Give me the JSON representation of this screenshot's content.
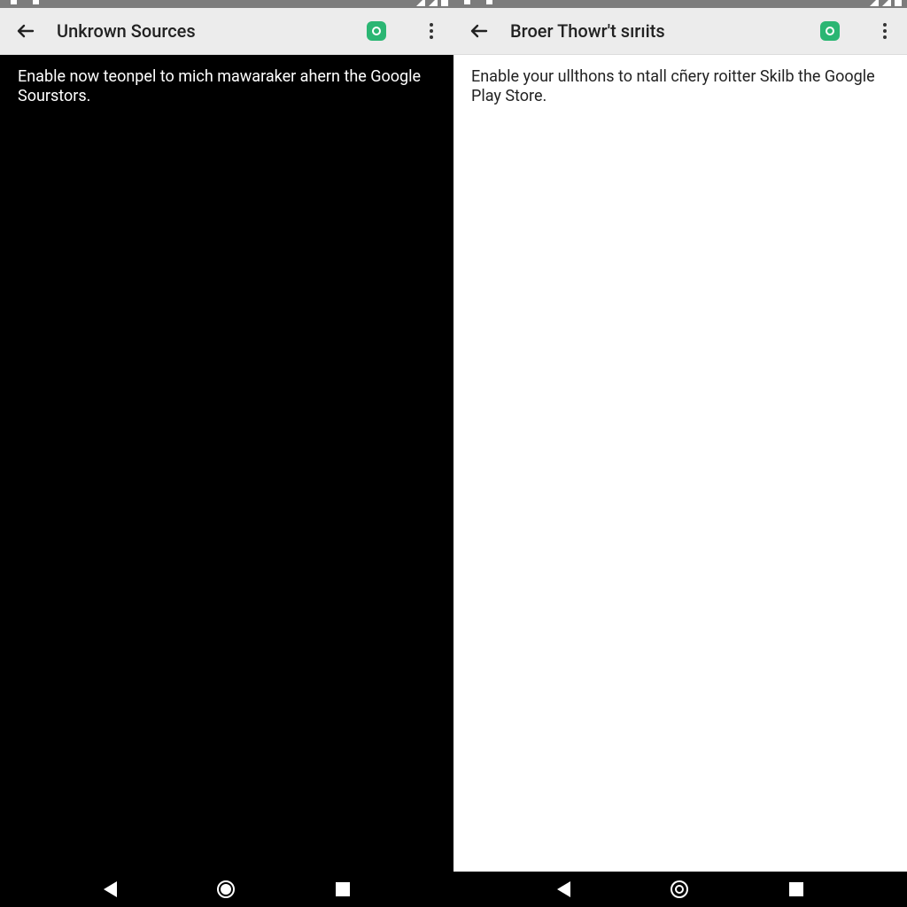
{
  "left": {
    "title": "Unkrown Sources",
    "description": "Enable now teonpel to mich mawaraker ahern the Google Sourstors."
  },
  "right": {
    "title": "Broer Thowr't sırıits",
    "description": "Enable your ullthons to ntall cñery roitter Skilb the Google Play Store."
  }
}
